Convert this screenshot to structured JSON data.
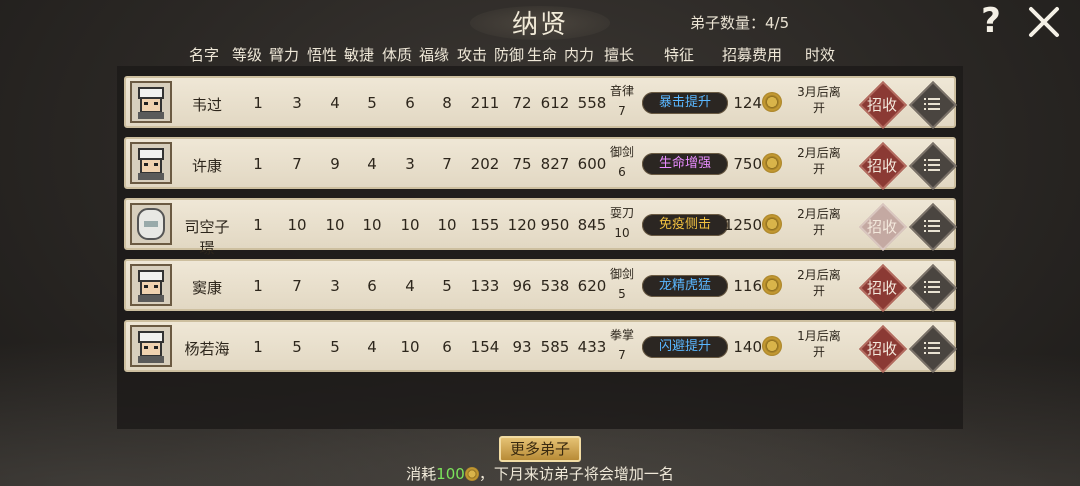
{
  "title": "纳贤",
  "disciple_count_label": "弟子数量：4/5",
  "help_label": "?",
  "header": {
    "name": "名字",
    "level": "等级",
    "strength": "臂力",
    "wisdom": "悟性",
    "agility": "敏捷",
    "constitution": "体质",
    "fortune": "福缘",
    "attack": "攻击",
    "defense": "防御",
    "life": "生命",
    "inner": "内力",
    "specialty": "擅长",
    "trait": "特征",
    "fee": "招募费用",
    "duration": "时效"
  },
  "recruit_label": "招收",
  "colors": {
    "trait_blue": "#5ab7ff",
    "trait_pink": "#e98cff",
    "trait_yellow": "#f0c040",
    "trait_green": "#7be37b",
    "recruit_red": "#8b3a34",
    "highlight_green": "#7be35b"
  },
  "rows": [
    {
      "name": "韦过",
      "level": "1",
      "strength": "3",
      "wisdom": "4",
      "agility": "5",
      "constitution": "6",
      "fortune": "8",
      "attack": "211",
      "defense": "72",
      "life": "612",
      "inner": "558",
      "skill_name": "音律",
      "skill_level": "7",
      "trait": "暴击提升",
      "trait_color": "#5ab7ff",
      "fee": "124",
      "term_line1": "3月后离",
      "term_line2": "开",
      "recruit_enabled": true,
      "avatar": "hooded-disciple"
    },
    {
      "name": "许康",
      "level": "1",
      "strength": "7",
      "wisdom": "9",
      "agility": "4",
      "constitution": "3",
      "fortune": "7",
      "attack": "202",
      "defense": "75",
      "life": "827",
      "inner": "600",
      "skill_name": "御剑",
      "skill_level": "6",
      "trait": "生命增强",
      "trait_color": "#e98cff",
      "fee": "750",
      "term_line1": "2月后离",
      "term_line2": "开",
      "recruit_enabled": true,
      "avatar": "hooded-disciple"
    },
    {
      "name": "司空子璟",
      "level": "1",
      "strength": "10",
      "wisdom": "10",
      "agility": "10",
      "constitution": "10",
      "fortune": "10",
      "attack": "155",
      "defense": "120",
      "life": "950",
      "inner": "845",
      "skill_name": "耍刀",
      "skill_level": "10",
      "trait": "免疫侧击",
      "trait_color": "#f0c040",
      "fee": "1250",
      "term_line1": "2月后离",
      "term_line2": "开",
      "recruit_enabled": false,
      "avatar": "white-masked-disciple"
    },
    {
      "name": "窦康",
      "level": "1",
      "strength": "7",
      "wisdom": "3",
      "agility": "6",
      "constitution": "4",
      "fortune": "5",
      "attack": "133",
      "defense": "96",
      "life": "538",
      "inner": "620",
      "skill_name": "御剑",
      "skill_level": "5",
      "trait": "龙精虎猛",
      "trait_color": "#5ab7ff",
      "fee": "116",
      "term_line1": "2月后离",
      "term_line2": "开",
      "recruit_enabled": true,
      "avatar": "hooded-disciple"
    },
    {
      "name": "杨若海",
      "level": "1",
      "strength": "5",
      "wisdom": "5",
      "agility": "4",
      "constitution": "10",
      "fortune": "6",
      "attack": "154",
      "defense": "93",
      "life": "585",
      "inner": "433",
      "skill_name": "拳掌",
      "skill_level": "7",
      "trait": "闪避提升",
      "trait_color": "#5ab7ff",
      "fee": "140",
      "term_line1": "1月后离",
      "term_line2": "开",
      "recruit_enabled": true,
      "avatar": "hooded-disciple"
    }
  ],
  "more_button": "更多弟子",
  "footer": {
    "prefix": "消耗",
    "cost": "100",
    "suffix": "，下月来访弟子将会增加一名"
  }
}
